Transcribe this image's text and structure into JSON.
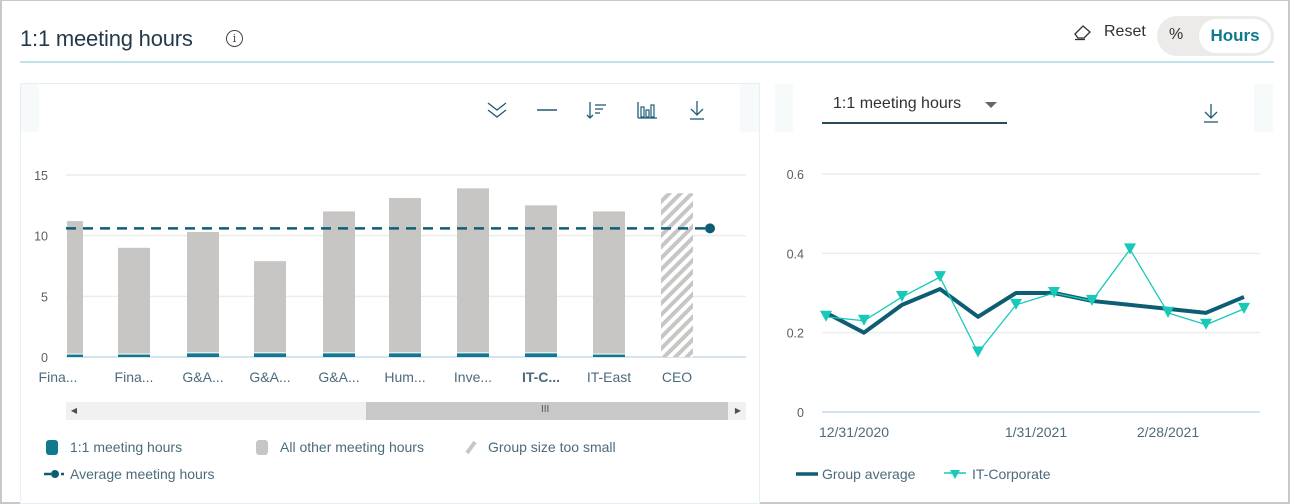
{
  "header": {
    "title": "1:1 meeting hours",
    "info_icon": "info-icon",
    "reset_label": "Reset",
    "reset_icon": "eraser-icon",
    "toggle": {
      "options": [
        "%",
        "Hours"
      ],
      "selected": "Hours"
    }
  },
  "left_panel": {
    "toolbar": [
      {
        "name": "expand-all-icon",
        "label": "Expand"
      },
      {
        "name": "average-line-icon",
        "label": "Show average"
      },
      {
        "name": "sort-icon",
        "label": "Sort"
      },
      {
        "name": "bar-chart-icon",
        "label": "Chart type"
      },
      {
        "name": "download-icon",
        "label": "Download"
      }
    ],
    "scrollbar": {
      "left_arrow": "◀",
      "right_arrow": "▶",
      "thumb_grip": "III"
    },
    "legend": [
      {
        "label": "1:1 meeting hours",
        "color": "#0f7a8f",
        "type": "square"
      },
      {
        "label": "All other meeting hours",
        "color": "#c8c6c4",
        "type": "square"
      },
      {
        "label": "Group size too small",
        "color": "#c8c6c4",
        "type": "hatch"
      },
      {
        "label": "Average meeting hours",
        "color": "#0e5e73",
        "type": "dashed-line-dot"
      }
    ]
  },
  "right_panel": {
    "dropdown": {
      "selected": "1:1 meeting hours"
    },
    "download_icon": "download-icon",
    "legend": [
      {
        "label": "Group average",
        "color": "#0e5e73",
        "type": "line"
      },
      {
        "label": "IT-Corporate",
        "color": "#17c9b8",
        "type": "line-triangle"
      }
    ]
  },
  "chart_data": [
    {
      "type": "bar",
      "stacked": true,
      "title": "1:1 meeting hours",
      "categories": [
        "Fina...",
        "Fina...",
        "G&A...",
        "G&A...",
        "G&A...",
        "Hum...",
        "Inve...",
        "IT-C...",
        "IT-East",
        "CEO"
      ],
      "highlighted_category": "IT-C...",
      "series": [
        {
          "name": "1:1 meeting hours",
          "color": "#0f7a8f",
          "values": [
            0.2,
            0.2,
            0.3,
            0.3,
            0.3,
            0.3,
            0.3,
            0.3,
            0.2,
            null
          ]
        },
        {
          "name": "All other meeting hours",
          "color": "#c8c6c4",
          "values": [
            11.0,
            8.8,
            10.0,
            7.6,
            11.7,
            12.8,
            13.6,
            12.2,
            11.8,
            null
          ]
        }
      ],
      "suppressed": {
        "name": "Group size too small",
        "category": "CEO",
        "value": 13.5
      },
      "reference_line": {
        "name": "Average meeting hours",
        "value": 10.6,
        "color": "#0e5e73"
      },
      "ylim": [
        0,
        15
      ],
      "yticks": [
        0,
        5,
        10,
        15
      ],
      "grid": true,
      "legend": "bottom"
    },
    {
      "type": "line",
      "title": "1:1 meeting hours",
      "x": [
        "12/24/2020",
        "12/31/2020",
        "1/7/2021",
        "1/14/2021",
        "1/21/2021",
        "1/28/2021",
        "2/4/2021",
        "2/11/2021",
        "2/18/2021",
        "2/25/2021",
        "3/4/2021",
        "3/11/2021"
      ],
      "xtick_labels": [
        "12/31/2020",
        "1/31/2021",
        "2/28/2021"
      ],
      "series": [
        {
          "name": "Group average",
          "color": "#0e5e73",
          "values": [
            0.25,
            0.2,
            0.27,
            0.31,
            0.24,
            0.3,
            0.3,
            0.28,
            0.27,
            0.26,
            0.25,
            0.29
          ]
        },
        {
          "name": "IT-Corporate",
          "color": "#17c9b8",
          "marker": "triangle-down",
          "values": [
            0.24,
            0.23,
            0.29,
            0.34,
            0.15,
            0.27,
            0.3,
            0.28,
            0.41,
            0.25,
            0.22,
            0.26
          ]
        }
      ],
      "ylim": [
        0,
        0.6
      ],
      "yticks": [
        0,
        0.2,
        0.4,
        0.6
      ],
      "grid": true,
      "legend": "bottom"
    }
  ]
}
